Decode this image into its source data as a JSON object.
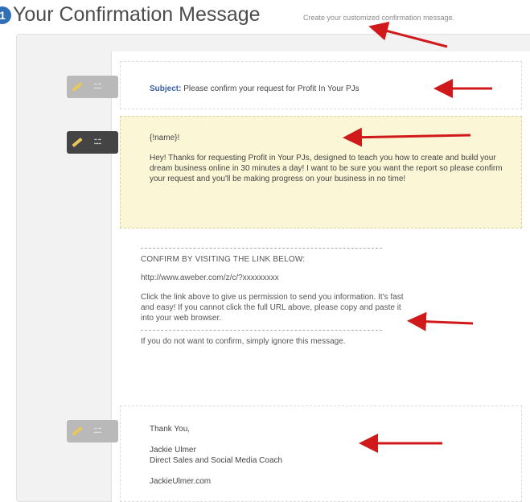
{
  "header": {
    "step_number": "1",
    "title": "Your Confirmation Message",
    "subtitle": "Create your customized confirmation message."
  },
  "subject": {
    "label": "Subject:",
    "text": "Please confirm your request for Profit In Your PJs"
  },
  "greeting": {
    "name_token": "{!name}!",
    "body": "Hey! Thanks for requesting Profit in Your PJs, designed to teach you how to create and build your dream business online in 30 minutes a day! I want to be sure you want the report so please confirm your request and you'll be making progress on your business in no time!"
  },
  "confirm": {
    "heading": "CONFIRM BY VISITING THE LINK BELOW:",
    "url": "http://www.aweber.com/z/c/?xxxxxxxxx",
    "instructions": "Click the link above to give us permission to send you information. It's fast and easy! If you cannot click the full URL above, please copy and paste it into your web browser.",
    "footer": "If you do not want to confirm, simply ignore this message."
  },
  "signature": {
    "thanks": "Thank You,",
    "name": "Jackie Ulmer",
    "role": "Direct Sales and Social Media Coach",
    "site": "JackieUlmer.com"
  },
  "colors": {
    "accent_blue": "#2f6fb5",
    "arrow_red": "#d0191b",
    "highlight_yellow": "#faf6d6"
  },
  "icons": {
    "edit": "pencil-icon",
    "annotation": "red-arrow"
  }
}
